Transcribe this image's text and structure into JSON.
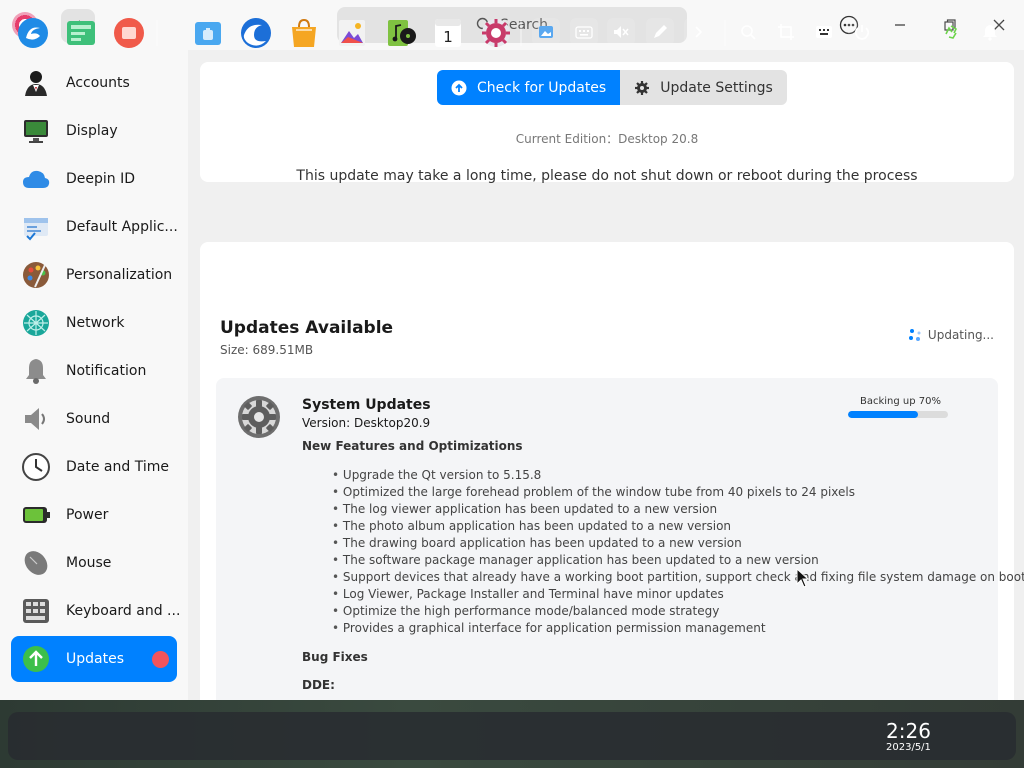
{
  "header": {
    "search_placeholder": "Search"
  },
  "sidebar": {
    "items": [
      {
        "label": "Accounts",
        "icon": "accounts-icon"
      },
      {
        "label": "Display",
        "icon": "display-icon"
      },
      {
        "label": "Deepin ID",
        "icon": "cloud-icon"
      },
      {
        "label": "Default Applic...",
        "icon": "default-apps-icon"
      },
      {
        "label": "Personalization",
        "icon": "palette-icon"
      },
      {
        "label": "Network",
        "icon": "network-icon"
      },
      {
        "label": "Notification",
        "icon": "bell-icon"
      },
      {
        "label": "Sound",
        "icon": "speaker-icon"
      },
      {
        "label": "Date and Time",
        "icon": "clock-icon"
      },
      {
        "label": "Power",
        "icon": "battery-icon"
      },
      {
        "label": "Mouse",
        "icon": "mouse-icon"
      },
      {
        "label": "Keyboard and ...",
        "icon": "keyboard-icon"
      },
      {
        "label": "Updates",
        "icon": "update-arrow-icon",
        "active": true
      }
    ]
  },
  "tabs": {
    "check": "Check for Updates",
    "settings": "Update Settings"
  },
  "edition": "Current Edition：Desktop 20.8",
  "notice": "This update may take a long time, please do not shut down or reboot during the process",
  "updates": {
    "title": "Updates Available",
    "size": "Size: 689.51MB",
    "status": "Updating..."
  },
  "system_update": {
    "name": "System Updates",
    "version": "Version: Desktop20.9",
    "section_features": "New Features and Optimizations",
    "features": [
      "Upgrade the Qt version to 5.15.8",
      "Optimized the large forehead problem of the window tube from 40 pixels to 24 pixels",
      "The log viewer application has been updated to a new version",
      "The photo album application has been updated to a new version",
      "The drawing board application has been updated to a new version",
      "The software package manager application has been updated to a new version",
      "Support devices that already have a working boot partition, support check and fixing file system damage on boot",
      "Log Viewer, Package Installer and Terminal have minor updates",
      "Optimize the high performance mode/balanced mode strategy",
      "Provides a graphical interface for application permission management"
    ],
    "section_bugs": "Bug Fixes",
    "section_dde": "DDE:",
    "progress_label": "Backing up 70%",
    "progress": 0.7
  },
  "dock": {
    "time": "2:26",
    "date": "2023/5/1",
    "calendar_day": "1"
  },
  "colors": {
    "accent": "#0081ff",
    "badge": "#f2545b"
  }
}
